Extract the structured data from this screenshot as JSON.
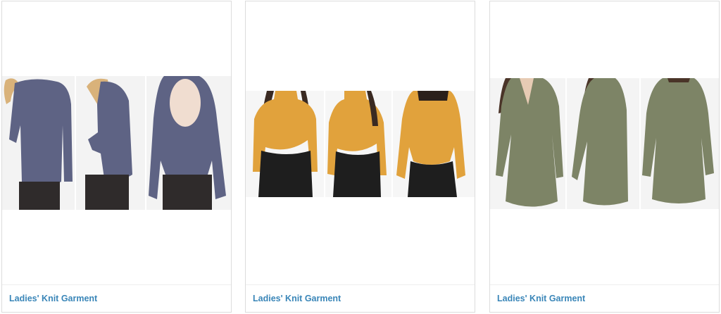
{
  "products": [
    {
      "title": "Ladies' Knit Garment",
      "image_icon": "photo-icon",
      "garment_color": "#5e6384"
    },
    {
      "title": "Ladies' Knit Garment",
      "image_icon": "photo-icon",
      "garment_color": "#e1a23c"
    },
    {
      "title": "Ladies' Knit Garment",
      "image_icon": "photo-icon",
      "garment_color": "#7d8466"
    }
  ],
  "colors": {
    "link": "#3a86b8",
    "border": "#dcdcdc"
  }
}
